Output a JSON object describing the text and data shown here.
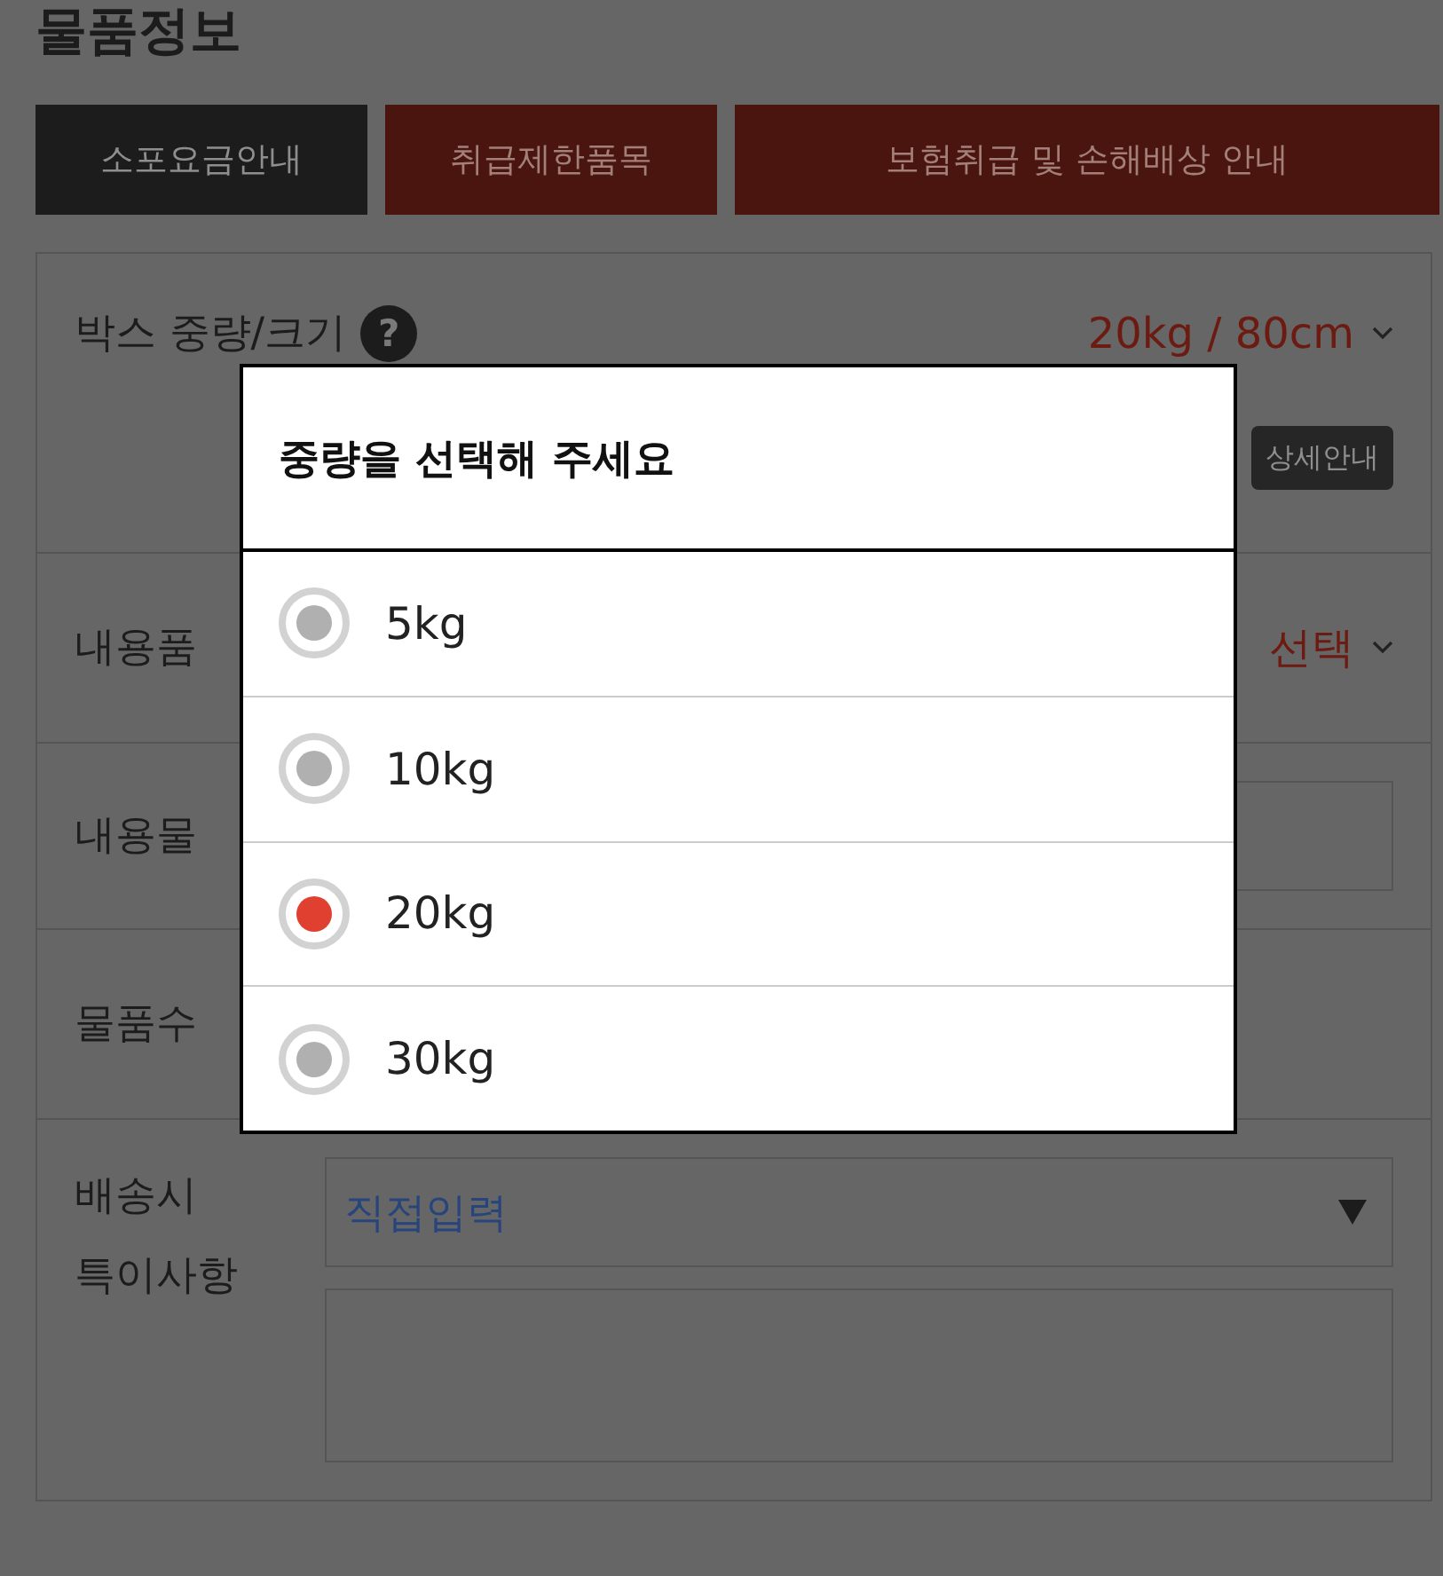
{
  "page": {
    "title": "물품정보"
  },
  "buttons": [
    {
      "label": "소포요금안내",
      "kind": "dark"
    },
    {
      "label": "취급제한품목",
      "kind": "red"
    },
    {
      "label": "보험취급 및 손해배상 안내",
      "kind": "red"
    }
  ],
  "form_rows": [
    {
      "kind": "select",
      "label": "박스 중량/크기",
      "help": "?",
      "value": "20kg / 80cm",
      "detail_button": "상세안내"
    },
    {
      "kind": "select",
      "label": "내용품",
      "value": "선택"
    },
    {
      "kind": "input",
      "label": "내용물"
    },
    {
      "kind": "plain",
      "label": "물품수"
    },
    {
      "kind": "notes",
      "label": "배송시 특이사항",
      "dropdown_value": "직접입력"
    }
  ],
  "dialog": {
    "title": "중량을 선택해 주세요",
    "options": [
      {
        "label": "5kg",
        "selected": false
      },
      {
        "label": "10kg",
        "selected": false
      },
      {
        "label": "20kg",
        "selected": true
      },
      {
        "label": "30kg",
        "selected": false
      }
    ]
  }
}
